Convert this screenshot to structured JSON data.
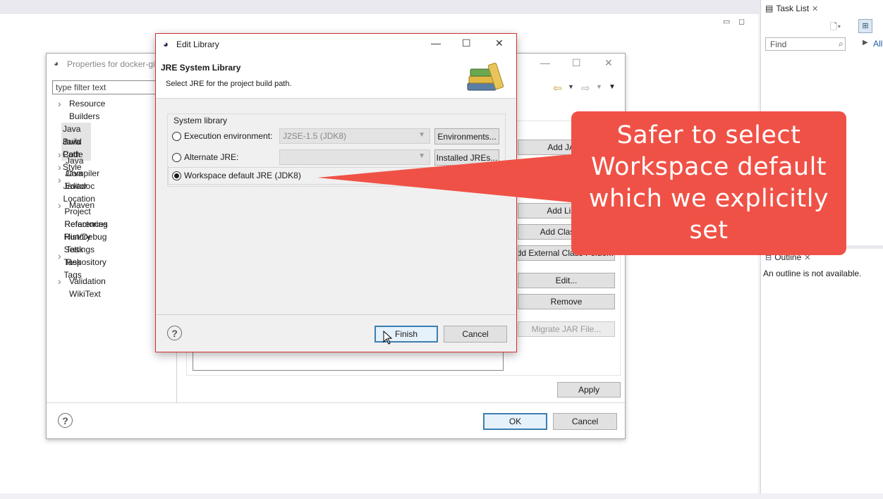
{
  "workspace": {
    "task_list": {
      "title": "Task List",
      "find_placeholder": "Find",
      "all_label": "All"
    },
    "outline": {
      "title": "Outline",
      "message": "An outline is not available."
    }
  },
  "properties_dialog": {
    "title": "Properties for docker-gi",
    "filter_placeholder": "type filter text",
    "tree": [
      {
        "label": "Resource",
        "expandable": true
      },
      {
        "label": "Builders",
        "expandable": false
      },
      {
        "label": "Git",
        "expandable": false
      },
      {
        "label": "Java Build Path",
        "expandable": false,
        "selected": true
      },
      {
        "label": "Java Code Style",
        "expandable": true
      },
      {
        "label": "Java Compiler",
        "expandable": true
      },
      {
        "label": "Java Editor",
        "expandable": true
      },
      {
        "label": "Javadoc Location",
        "expandable": false
      },
      {
        "label": "Maven",
        "expandable": true
      },
      {
        "label": "Project References",
        "expandable": false
      },
      {
        "label": "Refactoring History",
        "expandable": false
      },
      {
        "label": "Run/Debug Settings",
        "expandable": false
      },
      {
        "label": "Task Repository",
        "expandable": true
      },
      {
        "label": "Task Tags",
        "expandable": false
      },
      {
        "label": "Validation",
        "expandable": true
      },
      {
        "label": "WikiText",
        "expandable": false
      }
    ],
    "side_buttons": {
      "add_jars": "Add JARs",
      "add_library": "Add Librar",
      "add_class_folder": "Add Class Fol",
      "add_external_class_folder": "dd External Class Folder...",
      "edit": "Edit...",
      "remove": "Remove",
      "migrate_jar": "Migrate JAR File..."
    },
    "apply_label": "Apply",
    "ok_label": "OK",
    "cancel_label": "Cancel",
    "help_symbol": "?"
  },
  "edit_library": {
    "title": "Edit Library",
    "header_title": "JRE System Library",
    "header_desc": "Select JRE for the project build path.",
    "group_label": "System library",
    "options": {
      "execution_env": {
        "label": "Execution environment:",
        "value": "J2SE-1.5 (JDK8)",
        "button": "Environments..."
      },
      "alternate_jre": {
        "label": "Alternate JRE:",
        "value": "",
        "button": "Installed JREs..."
      },
      "workspace_default": {
        "label": "Workspace default JRE (JDK8)",
        "selected": true
      }
    },
    "finish_label": "Finish",
    "cancel_label": "Cancel",
    "help_symbol": "?"
  },
  "callout": {
    "text": "Safer to select Workspace default which we explicitly set",
    "color": "#f05146"
  }
}
